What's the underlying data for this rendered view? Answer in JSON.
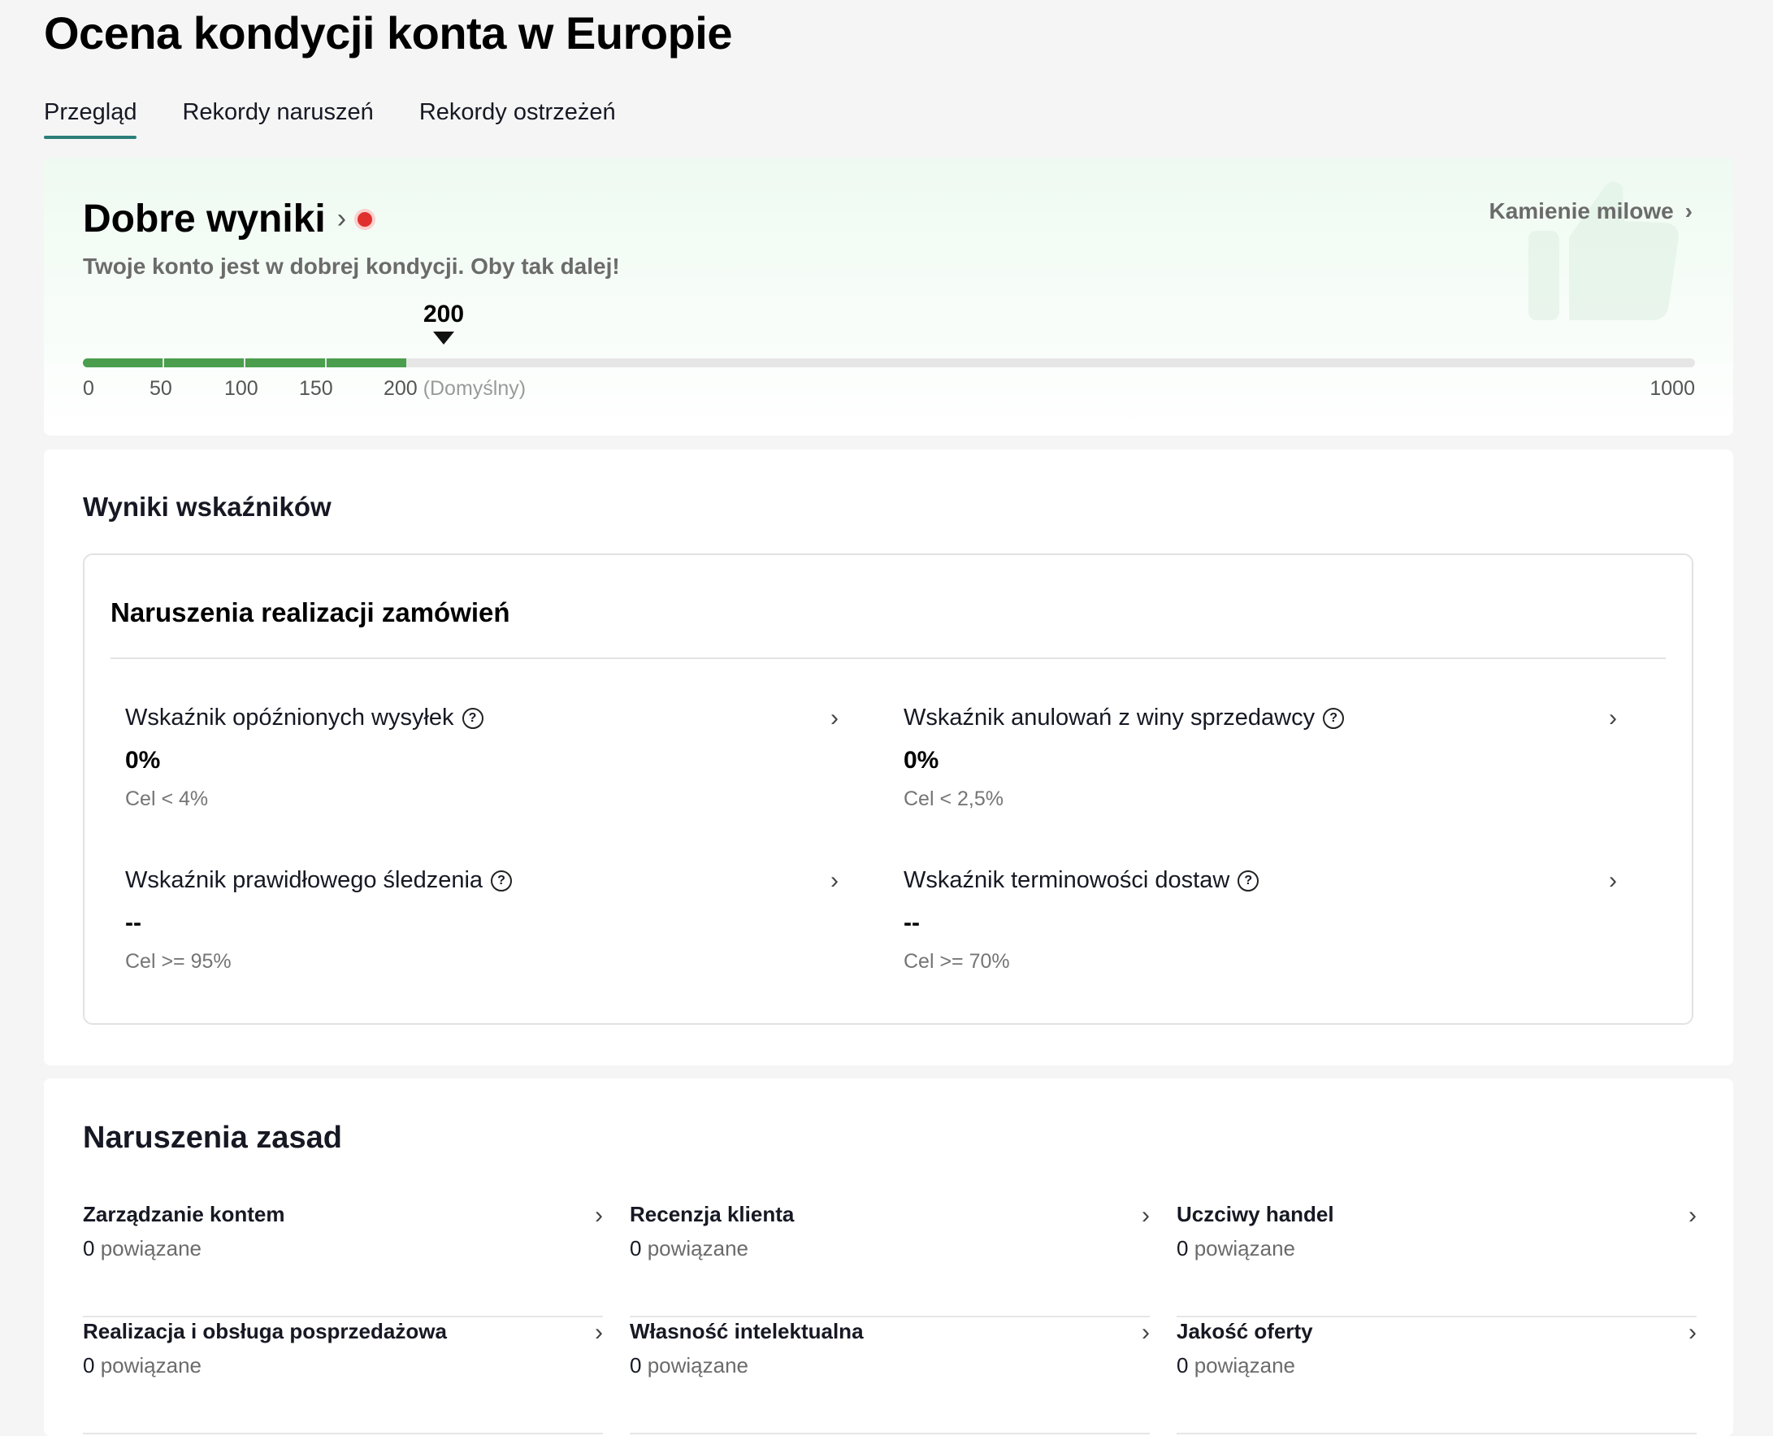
{
  "page": {
    "title": "Ocena kondycji konta w Europie"
  },
  "tabs": [
    {
      "label": "Przegląd",
      "active": true
    },
    {
      "label": "Rekordy naruszeń",
      "active": false
    },
    {
      "label": "Rekordy ostrzeżeń",
      "active": false
    }
  ],
  "health": {
    "title": "Dobre wyniki",
    "subtitle": "Twoje konto jest w dobrej kondycji. Oby tak dalej!",
    "milestones_label": "Kamienie milowe",
    "score": "200",
    "score_value": 200,
    "max_score": 1000,
    "ticks": [
      "0",
      "50",
      "100",
      "150",
      "200",
      "1000"
    ],
    "default_label": "(Domyślny)",
    "bar_color": "#4a9e4d",
    "status_dot_color": "#e0302d"
  },
  "metrics": {
    "section_title": "Wyniki wskaźników",
    "group_title": "Naruszenia realizacji zamówień",
    "items": [
      {
        "label": "Wskaźnik opóźnionych wysyłek",
        "value": "0%",
        "target": "Cel < 4%"
      },
      {
        "label": "Wskaźnik anulowań z winy sprzedawcy",
        "value": "0%",
        "target": "Cel < 2,5%"
      },
      {
        "label": "Wskaźnik prawidłowego śledzenia",
        "value": "--",
        "target": "Cel >= 95%"
      },
      {
        "label": "Wskaźnik terminowości dostaw",
        "value": "--",
        "target": "Cel >= 70%"
      }
    ]
  },
  "policy": {
    "section_title": "Naruszenia zasad",
    "related_label": "powiązane",
    "items": [
      {
        "name": "Zarządzanie kontem",
        "count": "0"
      },
      {
        "name": "Recenzja klienta",
        "count": "0"
      },
      {
        "name": "Uczciwy handel",
        "count": "0"
      },
      {
        "name": "Realizacja i obsługa posprzedażowa",
        "count": "0"
      },
      {
        "name": "Własność intelektualna",
        "count": "0"
      },
      {
        "name": "Jakość oferty",
        "count": "0"
      }
    ]
  }
}
